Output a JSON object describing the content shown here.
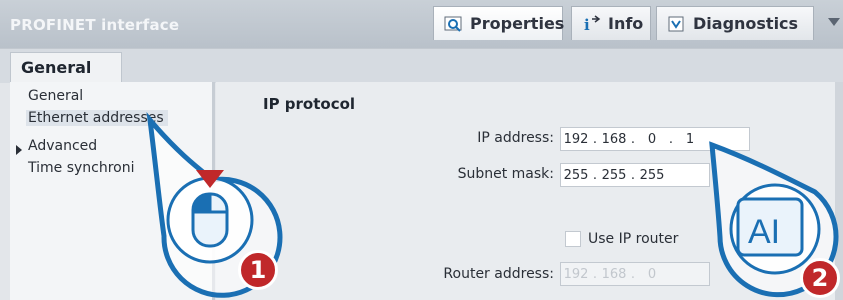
{
  "header": {
    "title": "PROFINET interface",
    "tabs": [
      {
        "label": "Properties",
        "icon": "properties-icon"
      },
      {
        "label": "Info",
        "icon": "info-icon"
      },
      {
        "label": "Diagnostics",
        "icon": "diagnostics-icon"
      }
    ]
  },
  "subtabs": {
    "general": "General"
  },
  "sidebar": {
    "items": [
      {
        "label": "General"
      },
      {
        "label": "Ethernet addresses"
      },
      {
        "label": "Advanced"
      },
      {
        "label": "Time synchroni"
      }
    ]
  },
  "main": {
    "heading": "IP protocol",
    "ip_label": "IP address:",
    "ip": [
      "192",
      "168",
      "0",
      "1"
    ],
    "mask_label": "Subnet mask:",
    "mask": [
      "255",
      "255",
      "255"
    ],
    "use_router_label": "Use IP router",
    "router_label": "Router address:",
    "router": [
      "192",
      "168",
      "0"
    ]
  },
  "annotations": {
    "step1": "1",
    "step2": "2",
    "text_cursor_label": "AI"
  },
  "colors": {
    "accent": "#1a6fb3",
    "badge": "#c0282a"
  }
}
